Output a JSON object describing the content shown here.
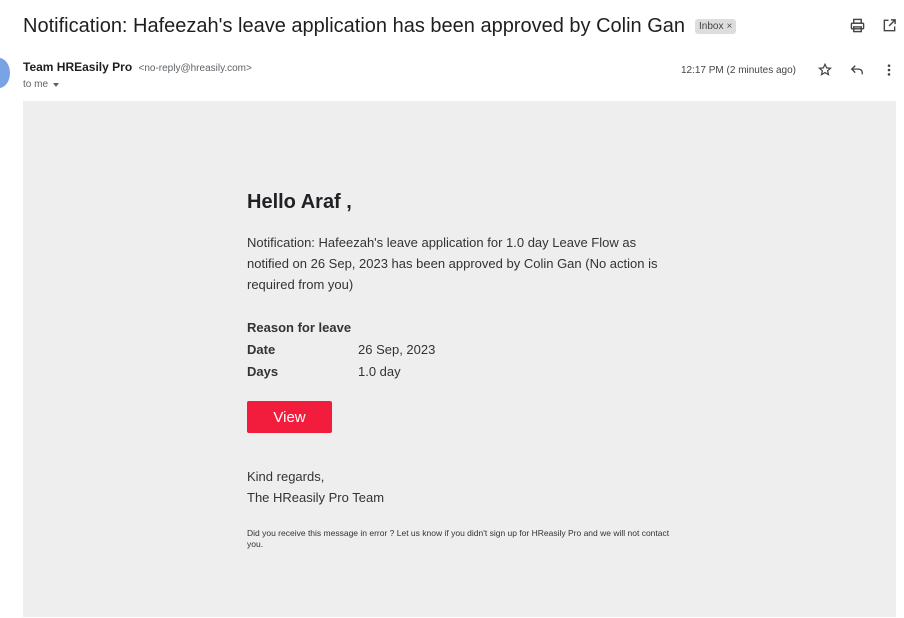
{
  "email": {
    "subject": "Notification: Hafeezah's leave application has been approved by Colin Gan",
    "label": "Inbox",
    "label_remove": "×",
    "sender_name": "Team HREasily Pro",
    "sender_email": "<no-reply@hreasily.com>",
    "to": "to me",
    "timestamp": "12:17 PM (2 minutes ago)"
  },
  "body": {
    "greeting": "Hello Araf ,",
    "notification": "Notification: Hafeezah's leave application for 1.0 day Leave Flow as notified on 26 Sep, 2023 has been approved by Colin Gan (No action is required from you)",
    "reason_label": "Reason for leave",
    "details": [
      {
        "label": "Date",
        "value": "26 Sep, 2023"
      },
      {
        "label": "Days",
        "value": "1.0 day"
      }
    ],
    "view_button": "View",
    "regards_line1": "Kind regards,",
    "regards_line2": "The HReasily Pro Team",
    "footer": "Did you receive this message in error ? Let us know if you didn't sign up for HReasily Pro and we will not contact you."
  },
  "colors": {
    "button": "#f21c3c",
    "body_bg": "#eeeeee"
  },
  "icons": [
    "print-icon",
    "open-new-window-icon",
    "star-icon",
    "reply-icon",
    "more-vert-icon"
  ]
}
